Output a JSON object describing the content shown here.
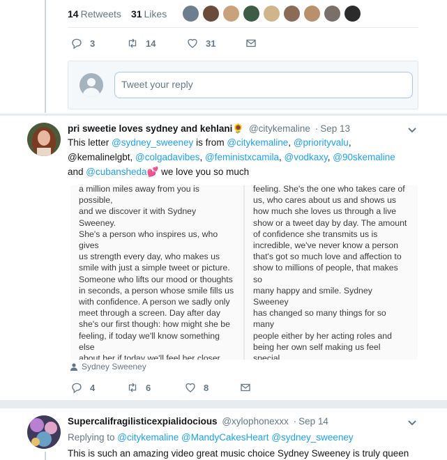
{
  "stats": {
    "retweets_count": "14",
    "retweets_label": "Retweets",
    "likes_count": "31",
    "likes_label": "Likes",
    "liker_avatars": [
      "#6d7f8f",
      "#6b4c3a",
      "#c9a27c",
      "#3d5c45",
      "#d0b48a",
      "#8a6b57",
      "#b8906c",
      "#7b6f6a",
      "#2b2b2b"
    ]
  },
  "main_actions": {
    "reply_count": "3",
    "retweet_count": "14",
    "like_count": "31"
  },
  "reply_box": {
    "placeholder": "Tweet your reply"
  },
  "tweet1": {
    "display_name": "pri sweetie loves sydney and kehlani",
    "emoji": "🌻",
    "handle": "@citykemaline",
    "date": "Sep 13",
    "text_parts": {
      "a": "This letter ",
      "m1": "@sydney_sweeney",
      "b": " is from ",
      "m2": "@citykemaline",
      "c": ", ",
      "m3": "@priorityvalu",
      "d": ",",
      "e": "@kemalinelgbt, ",
      "m4": "@colgadavibes",
      "f": ", ",
      "m5": "@feministxcamila",
      "g": ", ",
      "m6": "@vodkaxy",
      "h": ", ",
      "m7": "@90skemaline",
      "i": "and ",
      "m8": "@cubansheda",
      "heart": "💕",
      "j": " we love you so much"
    },
    "letter_left": "a million miles away from you is possible,\nand we discover it with Sydney Sweeney.\nShe's a person who inspires us, who gives\nus strength every day, who makes us\nsmile with just a simple tweet or picture.\nSomeone who lifts our mood or thoughts\nin seconds, a person whose smile fills us\nwith confidence. A person we sadly only\nmeet through a screen. Day after day\nshe's our first though: how might she be\nfeeling, if today we'll know something else\nabout her if today we'll feel her closer, and\neven if today will be one day less until the\nday our dreams will come true and we'll\nfinally be able to hug her and tell her how\nmuch she has changed our lives how",
    "letter_right": "feeling. She's the one who takes care of\nus, who cares about us and shows us\nhow much she loves us through a live\nshow or a tweet day by day. The amount\nof confidence she transmits us is\nincredible, we've never know a person\nthat's got so much love and affection to\nshow to millions of people, that makes so\nmany happy and smile. Sydney Sweeney\nhas changed so many things for so many\npeople either by her acting roles and\nbeing her own self making us feel special\nand unique, and making us believe that\nthere are reasons to move forward in life.\nShe makes us feel that way and gives us\nhope to fight for what we love and keep",
    "tagged_person": "Sydney Sweeney",
    "reply_count": "4",
    "retweet_count": "6",
    "like_count": "8"
  },
  "tweet2": {
    "display_name": "Supercalifragilisticexpialidocious",
    "handle": "@xylophonexxx",
    "date": "Sep 14",
    "replying_to_label": "Replying to ",
    "replying_to": [
      "@citykemaline",
      "@MandyCakesHeart",
      "@sydney_sweeney"
    ],
    "text": "This is such an amazing video great music choice Sydney Sweeney is truly queen"
  },
  "colors": {
    "accent": "#1da1f2",
    "secondary_text": "#657786",
    "divider": "#e6ecf0"
  },
  "icons": [
    "reply-icon",
    "retweet-icon",
    "like-icon",
    "dm-icon",
    "chevron-down-icon",
    "person-icon"
  ]
}
